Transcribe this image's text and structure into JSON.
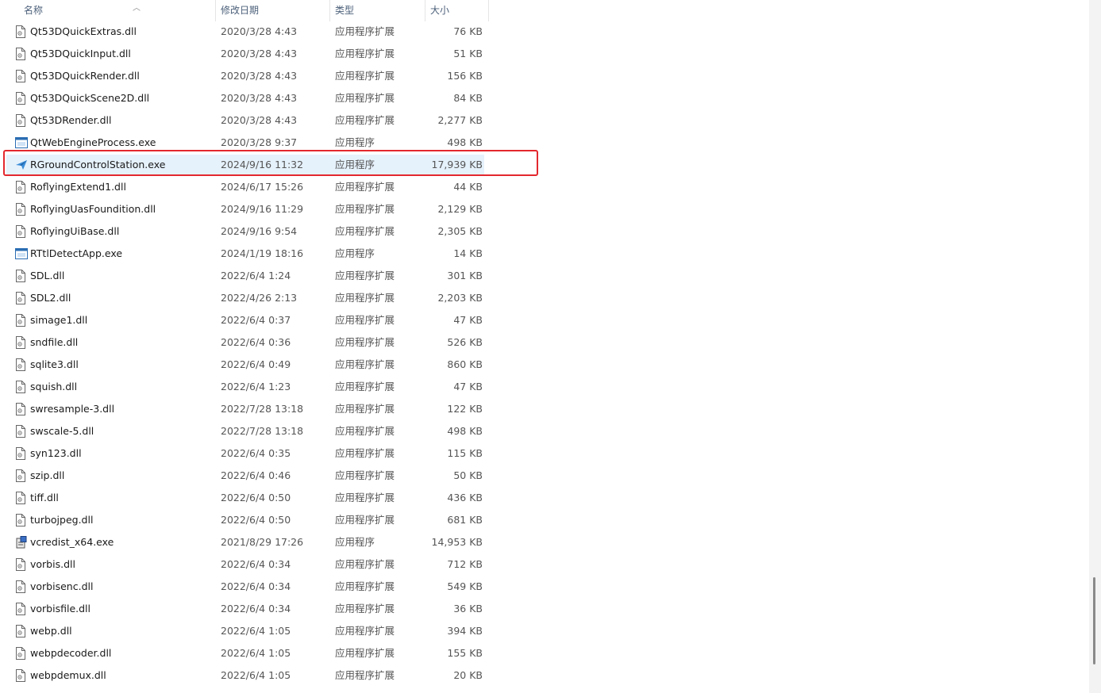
{
  "header": {
    "name": "名称",
    "date": "修改日期",
    "type": "类型",
    "size": "大小"
  },
  "files": [
    {
      "name": "Qt53DQuickExtras.dll",
      "date": "2020/3/28 4:43",
      "type": "应用程序扩展",
      "size": "76 KB",
      "icon": "dll"
    },
    {
      "name": "Qt53DQuickInput.dll",
      "date": "2020/3/28 4:43",
      "type": "应用程序扩展",
      "size": "51 KB",
      "icon": "dll"
    },
    {
      "name": "Qt53DQuickRender.dll",
      "date": "2020/3/28 4:43",
      "type": "应用程序扩展",
      "size": "156 KB",
      "icon": "dll"
    },
    {
      "name": "Qt53DQuickScene2D.dll",
      "date": "2020/3/28 4:43",
      "type": "应用程序扩展",
      "size": "84 KB",
      "icon": "dll"
    },
    {
      "name": "Qt53DRender.dll",
      "date": "2020/3/28 4:43",
      "type": "应用程序扩展",
      "size": "2,277 KB",
      "icon": "dll"
    },
    {
      "name": "QtWebEngineProcess.exe",
      "date": "2020/3/28 9:37",
      "type": "应用程序",
      "size": "498 KB",
      "icon": "exe"
    },
    {
      "name": "RGroundControlStation.exe",
      "date": "2024/9/16 11:32",
      "type": "应用程序",
      "size": "17,939 KB",
      "icon": "plane",
      "selected": true
    },
    {
      "name": "RoflyingExtend1.dll",
      "date": "2024/6/17 15:26",
      "type": "应用程序扩展",
      "size": "44 KB",
      "icon": "dll"
    },
    {
      "name": "RoflyingUasFoundition.dll",
      "date": "2024/9/16 11:29",
      "type": "应用程序扩展",
      "size": "2,129 KB",
      "icon": "dll"
    },
    {
      "name": "RoflyingUiBase.dll",
      "date": "2024/9/16 9:54",
      "type": "应用程序扩展",
      "size": "2,305 KB",
      "icon": "dll"
    },
    {
      "name": "RTtlDetectApp.exe",
      "date": "2024/1/19 18:16",
      "type": "应用程序",
      "size": "14 KB",
      "icon": "exe"
    },
    {
      "name": "SDL.dll",
      "date": "2022/6/4 1:24",
      "type": "应用程序扩展",
      "size": "301 KB",
      "icon": "dll"
    },
    {
      "name": "SDL2.dll",
      "date": "2022/4/26 2:13",
      "type": "应用程序扩展",
      "size": "2,203 KB",
      "icon": "dll"
    },
    {
      "name": "simage1.dll",
      "date": "2022/6/4 0:37",
      "type": "应用程序扩展",
      "size": "47 KB",
      "icon": "dll"
    },
    {
      "name": "sndfile.dll",
      "date": "2022/6/4 0:36",
      "type": "应用程序扩展",
      "size": "526 KB",
      "icon": "dll"
    },
    {
      "name": "sqlite3.dll",
      "date": "2022/6/4 0:49",
      "type": "应用程序扩展",
      "size": "860 KB",
      "icon": "dll"
    },
    {
      "name": "squish.dll",
      "date": "2022/6/4 1:23",
      "type": "应用程序扩展",
      "size": "47 KB",
      "icon": "dll"
    },
    {
      "name": "swresample-3.dll",
      "date": "2022/7/28 13:18",
      "type": "应用程序扩展",
      "size": "122 KB",
      "icon": "dll"
    },
    {
      "name": "swscale-5.dll",
      "date": "2022/7/28 13:18",
      "type": "应用程序扩展",
      "size": "498 KB",
      "icon": "dll"
    },
    {
      "name": "syn123.dll",
      "date": "2022/6/4 0:35",
      "type": "应用程序扩展",
      "size": "115 KB",
      "icon": "dll"
    },
    {
      "name": "szip.dll",
      "date": "2022/6/4 0:46",
      "type": "应用程序扩展",
      "size": "50 KB",
      "icon": "dll"
    },
    {
      "name": "tiff.dll",
      "date": "2022/6/4 0:50",
      "type": "应用程序扩展",
      "size": "436 KB",
      "icon": "dll"
    },
    {
      "name": "turbojpeg.dll",
      "date": "2022/6/4 0:50",
      "type": "应用程序扩展",
      "size": "681 KB",
      "icon": "dll"
    },
    {
      "name": "vcredist_x64.exe",
      "date": "2021/8/29 17:26",
      "type": "应用程序",
      "size": "14,953 KB",
      "icon": "installer"
    },
    {
      "name": "vorbis.dll",
      "date": "2022/6/4 0:34",
      "type": "应用程序扩展",
      "size": "712 KB",
      "icon": "dll"
    },
    {
      "name": "vorbisenc.dll",
      "date": "2022/6/4 0:34",
      "type": "应用程序扩展",
      "size": "549 KB",
      "icon": "dll"
    },
    {
      "name": "vorbisfile.dll",
      "date": "2022/6/4 0:34",
      "type": "应用程序扩展",
      "size": "36 KB",
      "icon": "dll"
    },
    {
      "name": "webp.dll",
      "date": "2022/6/4 1:05",
      "type": "应用程序扩展",
      "size": "394 KB",
      "icon": "dll"
    },
    {
      "name": "webpdecoder.dll",
      "date": "2022/6/4 1:05",
      "type": "应用程序扩展",
      "size": "155 KB",
      "icon": "dll"
    },
    {
      "name": "webpdemux.dll",
      "date": "2022/6/4 1:05",
      "type": "应用程序扩展",
      "size": "20 KB",
      "icon": "dll"
    }
  ],
  "colors": {
    "selection": "#e5f1fb",
    "highlight_border": "#e3282e",
    "header_text": "#4c607a"
  }
}
